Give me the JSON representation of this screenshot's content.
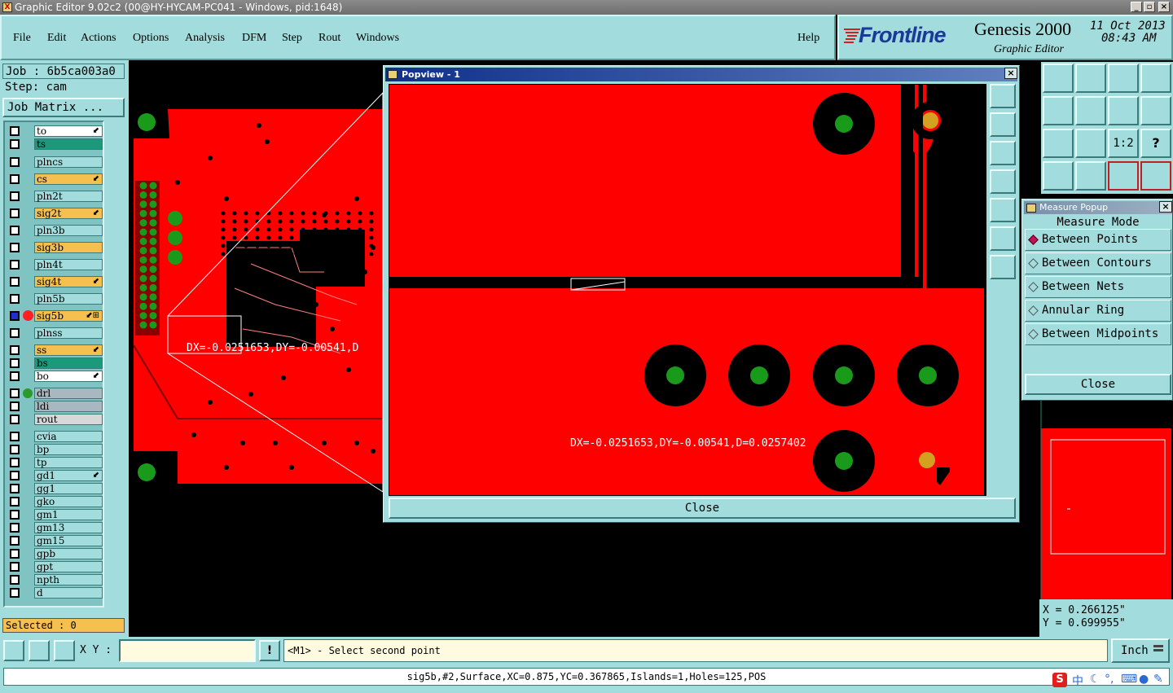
{
  "window": {
    "title": "Graphic Editor 9.02c2 (00@HY-HYCAM-PC041 - Windows, pid:1648)"
  },
  "menu": {
    "items": [
      "File",
      "Edit",
      "Actions",
      "Options",
      "Analysis",
      "DFM",
      "Step",
      "Rout",
      "Windows"
    ],
    "help": "Help"
  },
  "brand": {
    "logo": "Frontline",
    "product": "Genesis 2000",
    "subtitle": "Graphic Editor",
    "date": "11 Oct 2013",
    "time": "08:43 AM"
  },
  "job": {
    "job_line": "Job : 6b5ca003a0",
    "step_line": "Step: cam",
    "matrix_button": "Job Matrix ..."
  },
  "layers": [
    {
      "name": "to",
      "color": "#ffffff",
      "flag": "⬋"
    },
    {
      "name": "ts",
      "color": "#1a9a7a",
      "flag": ""
    },
    {
      "name": "plncs",
      "color": "#a3dcdc",
      "flag": ""
    },
    {
      "name": "cs",
      "color": "#f5c050",
      "flag": "⬋"
    },
    {
      "name": "pln2t",
      "color": "#a3dcdc",
      "flag": ""
    },
    {
      "name": "sig2t",
      "color": "#f5c050",
      "flag": "⬋"
    },
    {
      "name": "pln3b",
      "color": "#a3dcdc",
      "flag": ""
    },
    {
      "name": "sig3b",
      "color": "#f5c050",
      "flag": ""
    },
    {
      "name": "pln4t",
      "color": "#a3dcdc",
      "flag": ""
    },
    {
      "name": "sig4t",
      "color": "#f5c050",
      "flag": "⬋"
    },
    {
      "name": "pln5b",
      "color": "#a3dcdc",
      "flag": ""
    },
    {
      "name": "sig5b",
      "color": "#f5c050",
      "flag": "⬋⊞"
    },
    {
      "name": "plnss",
      "color": "#a3dcdc",
      "flag": ""
    },
    {
      "name": "ss",
      "color": "#f5c050",
      "flag": "⬋"
    },
    {
      "name": "bs",
      "color": "#1a9a7a",
      "flag": ""
    },
    {
      "name": "bo",
      "color": "#ffffff",
      "flag": "⬋"
    },
    {
      "name": "drl",
      "color": "#a9b8c0",
      "flag": ""
    },
    {
      "name": "ldi",
      "color": "#a9b8c0",
      "flag": ""
    },
    {
      "name": "rout",
      "color": "#d8d8d8",
      "flag": ""
    },
    {
      "name": "cvia",
      "color": "#a3dcdc",
      "flag": ""
    },
    {
      "name": "bp",
      "color": "#a3dcdc",
      "flag": ""
    },
    {
      "name": "tp",
      "color": "#a3dcdc",
      "flag": ""
    },
    {
      "name": "gd1",
      "color": "#a3dcdc",
      "flag": "⬋"
    },
    {
      "name": "gg1",
      "color": "#a3dcdc",
      "flag": ""
    },
    {
      "name": "gko",
      "color": "#a3dcdc",
      "flag": ""
    },
    {
      "name": "gm1",
      "color": "#a3dcdc",
      "flag": ""
    },
    {
      "name": "gm13",
      "color": "#a3dcdc",
      "flag": ""
    },
    {
      "name": "gm15",
      "color": "#a3dcdc",
      "flag": ""
    },
    {
      "name": "gpb",
      "color": "#a3dcdc",
      "flag": ""
    },
    {
      "name": "gpt",
      "color": "#a3dcdc",
      "flag": ""
    },
    {
      "name": "npth",
      "color": "#a3dcdc",
      "flag": ""
    },
    {
      "name": "d",
      "color": "#a3dcdc",
      "flag": ""
    }
  ],
  "selected": "Selected : 0",
  "canvas": {
    "measure_label": "DX=-0.0251653,DY=-0.00541,D"
  },
  "popview": {
    "title": "Popview - 1",
    "measure_label": "DX=-0.0251653,DY=-0.00541,D=0.0257402",
    "close": "Close"
  },
  "measure": {
    "title": "Measure Popup",
    "heading": "Measure Mode",
    "options": [
      "Between Points",
      "Between Contours",
      "Between Nets",
      "Annular Ring",
      "Between Midpoints"
    ],
    "selected": "Between Points",
    "close": "Close"
  },
  "tools_panel": {
    "zoom_ratio": "1:2",
    "help": "?"
  },
  "coords": {
    "x": "X = 0.266125\"",
    "y": "Y = 0.699955\""
  },
  "cmd": {
    "xy_label": "X Y :",
    "input_value": "",
    "exclaim": "!",
    "prompt": "<M1> - Select second point",
    "unit": "Inch"
  },
  "status": {
    "text": "sig5b,#2,Surface,XC=0.875,YC=0.367865,Islands=1,Holes=125,POS"
  },
  "ime": {
    "s": "S",
    "zh": "中",
    "dot": "°,"
  }
}
